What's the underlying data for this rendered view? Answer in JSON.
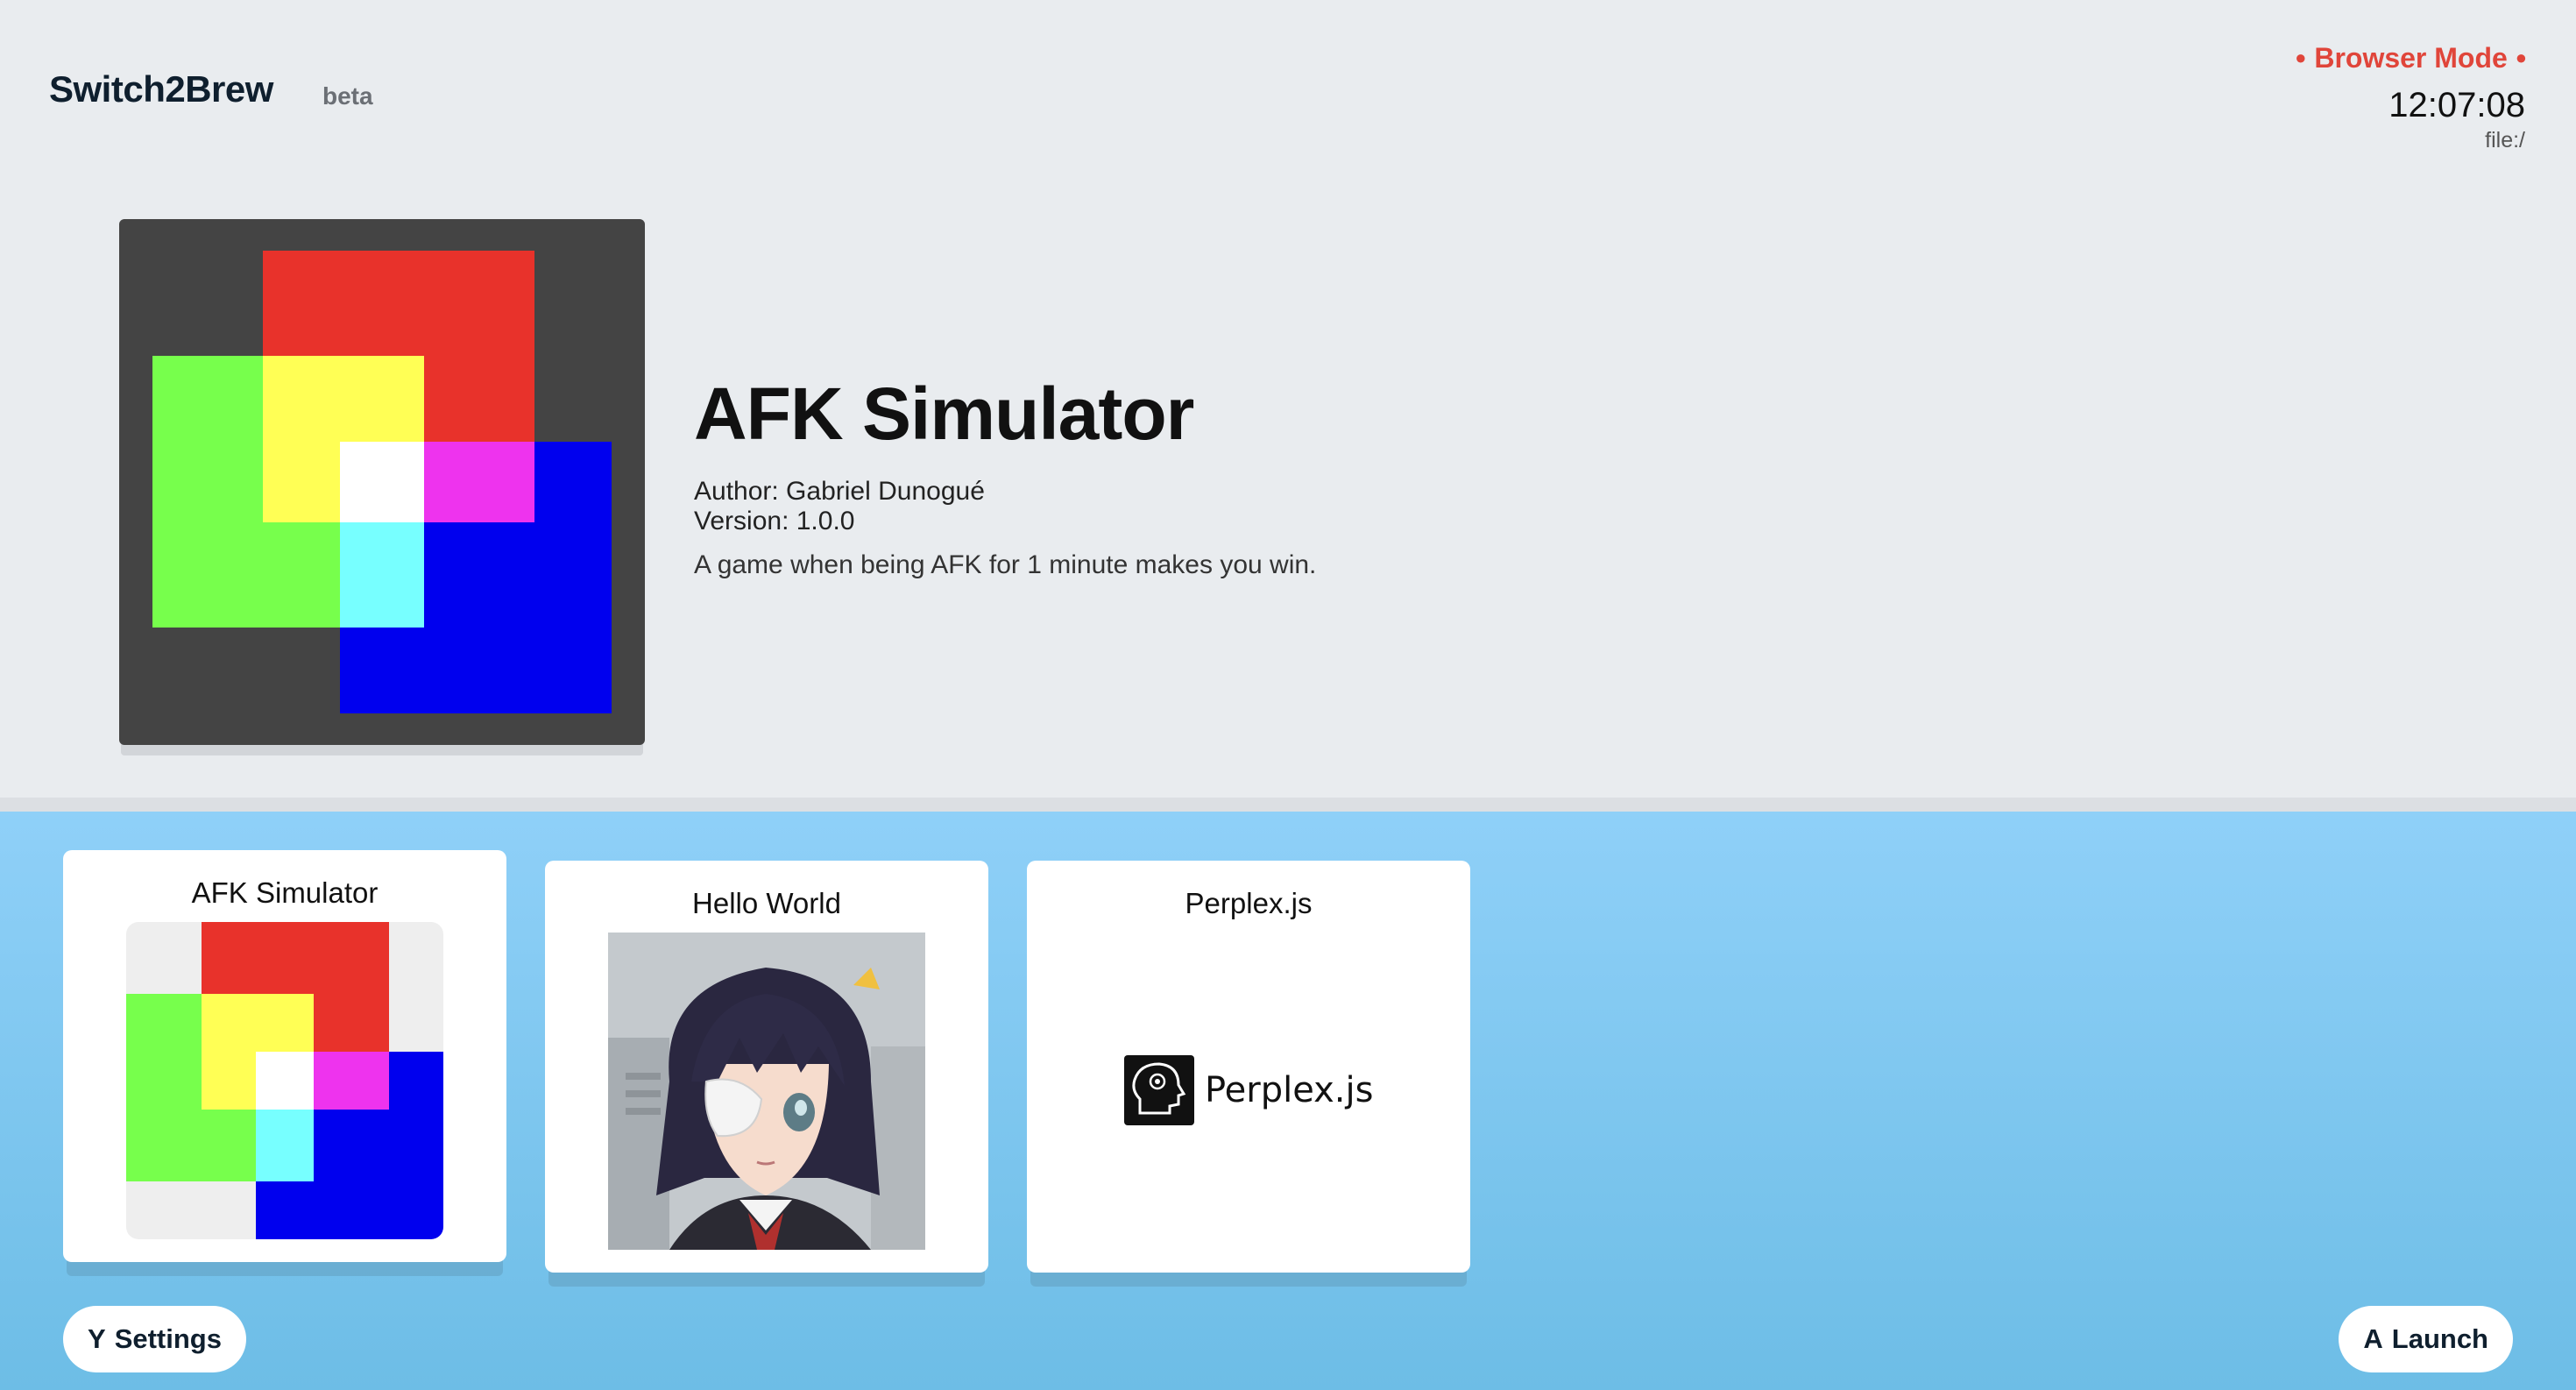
{
  "header": {
    "brand": "Switch2Brew",
    "badge": "beta",
    "mode_label": "Browser Mode",
    "clock": "12:07:08",
    "url": "file:/"
  },
  "hero": {
    "title": "AFK Simulator",
    "author_line": "Author: Gabriel Dunogué",
    "version_line": "Version: 1.0.0",
    "description": "A game when being AFK for 1 minute makes you win."
  },
  "apps": [
    {
      "title": "AFK Simulator",
      "icon": "afk-simulator-icon",
      "selected": true
    },
    {
      "title": "Hello World",
      "icon": "anime-character-icon",
      "selected": false
    },
    {
      "title": "Perplex.js",
      "icon": "perplex-logo-icon",
      "logo_text": "Perplex.js",
      "selected": false
    }
  ],
  "footer": {
    "settings_key": "Y",
    "settings_label": "Settings",
    "launch_key": "A",
    "launch_label": "Launch"
  },
  "colors": {
    "mode_red": "#e0453a",
    "shelf_top": "#8fd0f8",
    "shelf_bottom": "#6dbde6",
    "red": "#e8322b",
    "green": "#77ff4c",
    "blue": "#0000ee",
    "yellow": "#ffff55",
    "magenta": "#ee33ee",
    "cyan": "#77ffff"
  }
}
